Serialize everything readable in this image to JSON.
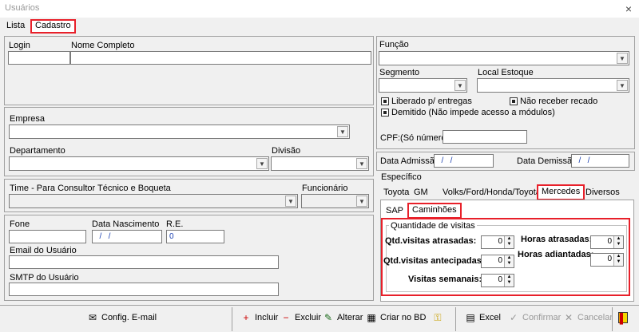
{
  "window": {
    "title": "Usuários",
    "close_icon": "×"
  },
  "tabs": {
    "lista": "Lista",
    "cadastro": "Cadastro"
  },
  "left": {
    "login_label": "Login",
    "login_value": "",
    "nome_label": "Nome Completo",
    "nome_value": "",
    "empresa_label": "Empresa",
    "empresa_value": "",
    "departamento_label": "Departamento",
    "departamento_value": "",
    "divisao_label": "Divisão",
    "divisao_value": "",
    "time_label": "Time - Para Consultor Técnico e Boqueta",
    "time_value": "",
    "funcionario_label": "Funcionário",
    "funcionario_value": "",
    "fone_label": "Fone",
    "fone_value": "",
    "nascimento_label": "Data Nascimento",
    "nascimento_value": "  /   /",
    "re_label": "R.E.",
    "re_value": "0",
    "email_label": "Email do Usuário",
    "email_value": "",
    "smtp_label": "SMTP do Usuário",
    "smtp_value": ""
  },
  "right": {
    "funcao_label": "Função",
    "funcao_value": "",
    "segmento_label": "Segmento",
    "segmento_value": "",
    "estoque_label": "Local Estoque",
    "estoque_value": "",
    "liberado_label": "Liberado p/ entregas",
    "nao_receber_label": "Não receber recado",
    "demitido_label": "Demitido (Não impede acesso a módulos)",
    "cpf_label": "CPF:(Só números)",
    "cpf_value": "",
    "admissao_label": "Data Admissão",
    "admissao_value": "  /   /",
    "demissao_label": "Data Demissão",
    "demissao_value": "  /   /",
    "especifico_label": "Específico",
    "spec_tabs": [
      "Toyota",
      "GM",
      "Volks/Ford/Honda/Toyota",
      "Mercedes",
      "Diversos"
    ],
    "sub_tabs": [
      "SAP",
      "Caminhões"
    ],
    "quantidade_label": "Quantidade de visitas",
    "atrasadas_label": "Qtd.visitas atrasadas:",
    "atrasadas_value": "0",
    "antecipadas_label": "Qtd.visitas antecipadas:",
    "antecipadas_value": "0",
    "semanais_label": "Visitas semanais:",
    "semanais_value": "0",
    "horas_atrasadas_label": "Horas atrasadas:",
    "horas_atrasadas_value": "0",
    "horas_adiantadas_label": "Horas adiantadas:",
    "horas_adiantadas_value": "0"
  },
  "toolbar": {
    "config_email": "Config. E-mail",
    "incluir": "Incluir",
    "excluir": "Excluir",
    "alterar": "Alterar",
    "criar_bd": "Criar no BD",
    "excel": "Excel",
    "confirmar": "Confirmar",
    "cancelar": "Cancelar"
  },
  "colors": {
    "highlight": "#e8202a",
    "date_text": "#1a3fb0"
  }
}
